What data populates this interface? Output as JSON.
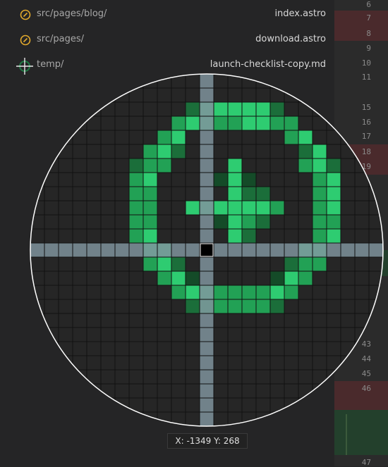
{
  "file_list": [
    {
      "dir": "src/pages/blog/",
      "file": "index.astro",
      "icon": "clock-icon"
    },
    {
      "dir": "src/pages/",
      "file": "download.astro",
      "icon": "clock-icon"
    },
    {
      "dir": "temp/",
      "file": "launch-checklist-copy.md",
      "icon": "crosshair-icon"
    }
  ],
  "gutter": {
    "line_numbers": [
      "6",
      "7",
      "8",
      "9",
      "10",
      "11",
      "15",
      "16",
      "17",
      "18",
      "19",
      "43",
      "44",
      "45",
      "46",
      "47"
    ],
    "colors": {
      "deleted": "#4a2a2c",
      "added": "#23402c",
      "background": "#2b2b2b"
    }
  },
  "magnifier": {
    "colors": {
      "crosshair": "#7f939c",
      "center": "#000000",
      "pixel_grid": "#111111",
      "ring": "#ffffff",
      "icon_green": "#2ecc71"
    }
  },
  "cursor_position": {
    "label": "X: -1349 Y: 268"
  }
}
